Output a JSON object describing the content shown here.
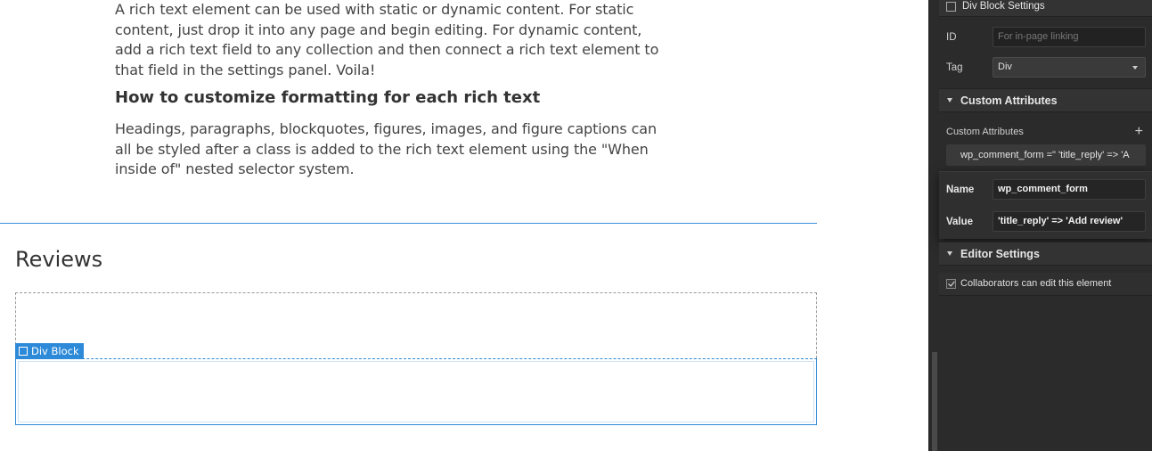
{
  "content": {
    "paragraph_1": "A rich text element can be used with static or dynamic content. For static content, just drop it into any page and begin editing. For dynamic content, add a rich text field to any collection and then connect a rich text element to that field in the settings panel. Voila!",
    "heading": "How to customize formatting for each rich text",
    "paragraph_2": "Headings, paragraphs, blockquotes, figures, images, and figure captions can all be styled after a class is added to the rich text element using the \"When inside of\" nested selector system.",
    "reviews_title": "Reviews",
    "selected_badge": "Div Block"
  },
  "panel": {
    "block_settings": "Div Block Settings",
    "id_label": "ID",
    "id_placeholder": "For in-page linking",
    "tag_label": "Tag",
    "tag_value": "Div",
    "custom_attributes_header": "Custom Attributes",
    "custom_attributes_label": "Custom Attributes",
    "add_icon": "+",
    "attribute_summary": "wp_comment_form =\" 'title_reply' => 'A",
    "name_label": "Name",
    "name_value": "wp_comment_form",
    "value_label": "Value",
    "value_value": "'title_reply' => 'Add review'",
    "editor_settings_header": "Editor Settings",
    "collaborators_label": "Collaborators can edit this element",
    "collaborators_checked": true
  },
  "colors": {
    "accent": "#2d8ad8",
    "panel_bg": "#2b2b2b"
  }
}
